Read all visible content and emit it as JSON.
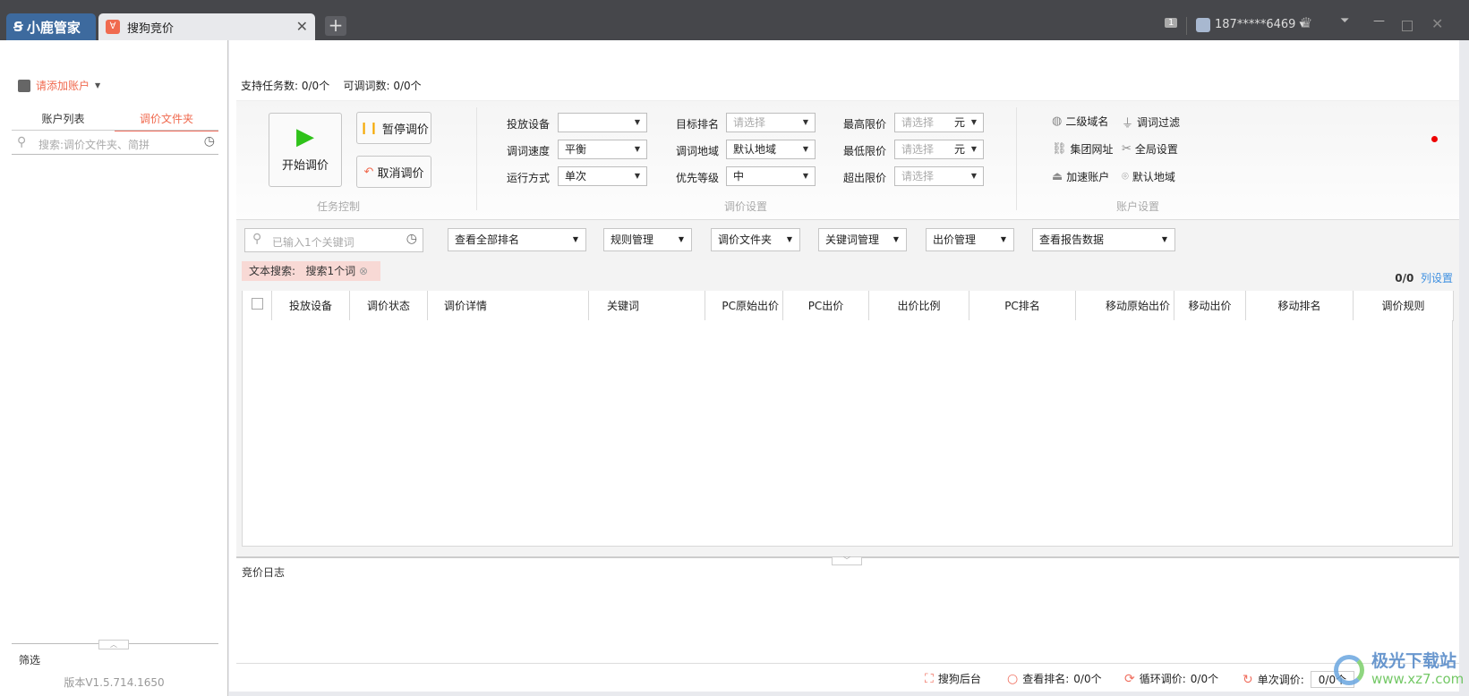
{
  "titlebar": {
    "app_name": "小鹿管家",
    "tab_title": "搜狗竞价",
    "tab_icon": "sogou-icon",
    "window_count": "1",
    "user": "187*****6469"
  },
  "sidebar": {
    "add_account": "请添加账户",
    "tabs": [
      "账户列表",
      "调价文件夹"
    ],
    "active_tab": 1,
    "search_placeholder": "搜索:调价文件夹、简拼",
    "filter": "筛选",
    "version": "版本V1.5.714.1650"
  },
  "stats": {
    "tasks_label": "支持任务数:",
    "tasks_value": "0/0个",
    "words_label": "可调词数:",
    "words_value": "0/0个"
  },
  "task_control": {
    "start": "开始调价",
    "pause": "暂停调价",
    "cancel": "取消调价",
    "group": "任务控制"
  },
  "price_settings": {
    "group": "调价设置",
    "fields": [
      {
        "label": "投放设备",
        "value": "",
        "placeholder": ""
      },
      {
        "label": "调词速度",
        "value": "平衡",
        "placeholder": ""
      },
      {
        "label": "运行方式",
        "value": "单次",
        "placeholder": ""
      },
      {
        "label": "目标排名",
        "value": "",
        "placeholder": "请选择"
      },
      {
        "label": "调词地域",
        "value": "默认地域",
        "placeholder": ""
      },
      {
        "label": "优先等级",
        "value": "中",
        "placeholder": ""
      },
      {
        "label": "最高限价",
        "value": "",
        "placeholder": "请选择",
        "unit": "元"
      },
      {
        "label": "最低限价",
        "value": "",
        "placeholder": "请选择",
        "unit": "元"
      },
      {
        "label": "超出限价",
        "value": "",
        "placeholder": "请选择"
      }
    ]
  },
  "account_settings": {
    "group": "账户设置",
    "items": [
      "二级域名",
      "调词过滤",
      "集团网址",
      "全局设置",
      "加速账户",
      "默认地域"
    ]
  },
  "filters": {
    "keyword_placeholder": "已输入1个关键词",
    "dropdowns": [
      "查看全部排名",
      "规则管理",
      "调价文件夹",
      "关键词管理",
      "出价管理",
      "查看报告数据"
    ]
  },
  "search_tag": {
    "label": "文本搜索:",
    "value": "搜索1个词"
  },
  "table": {
    "count": "0/0",
    "column_settings": "列设置",
    "columns": [
      "投放设备",
      "调价状态",
      "调价详情",
      "关键词",
      "PC原始出价",
      "PC出价",
      "出价比例",
      "PC排名",
      "移动原始出价",
      "移动出价",
      "移动排名",
      "调价规则"
    ]
  },
  "log": {
    "title": "竞价日志"
  },
  "statusbar": {
    "backend": "搜狗后台",
    "rank_label": "查看排名:",
    "rank_value": "0/0个",
    "loop_label": "循环调价:",
    "loop_value": "0/0个",
    "single_label": "单次调价:",
    "single_value": "0/0个"
  },
  "watermark": {
    "name": "极光下载站",
    "url": "www.xz7.com"
  }
}
